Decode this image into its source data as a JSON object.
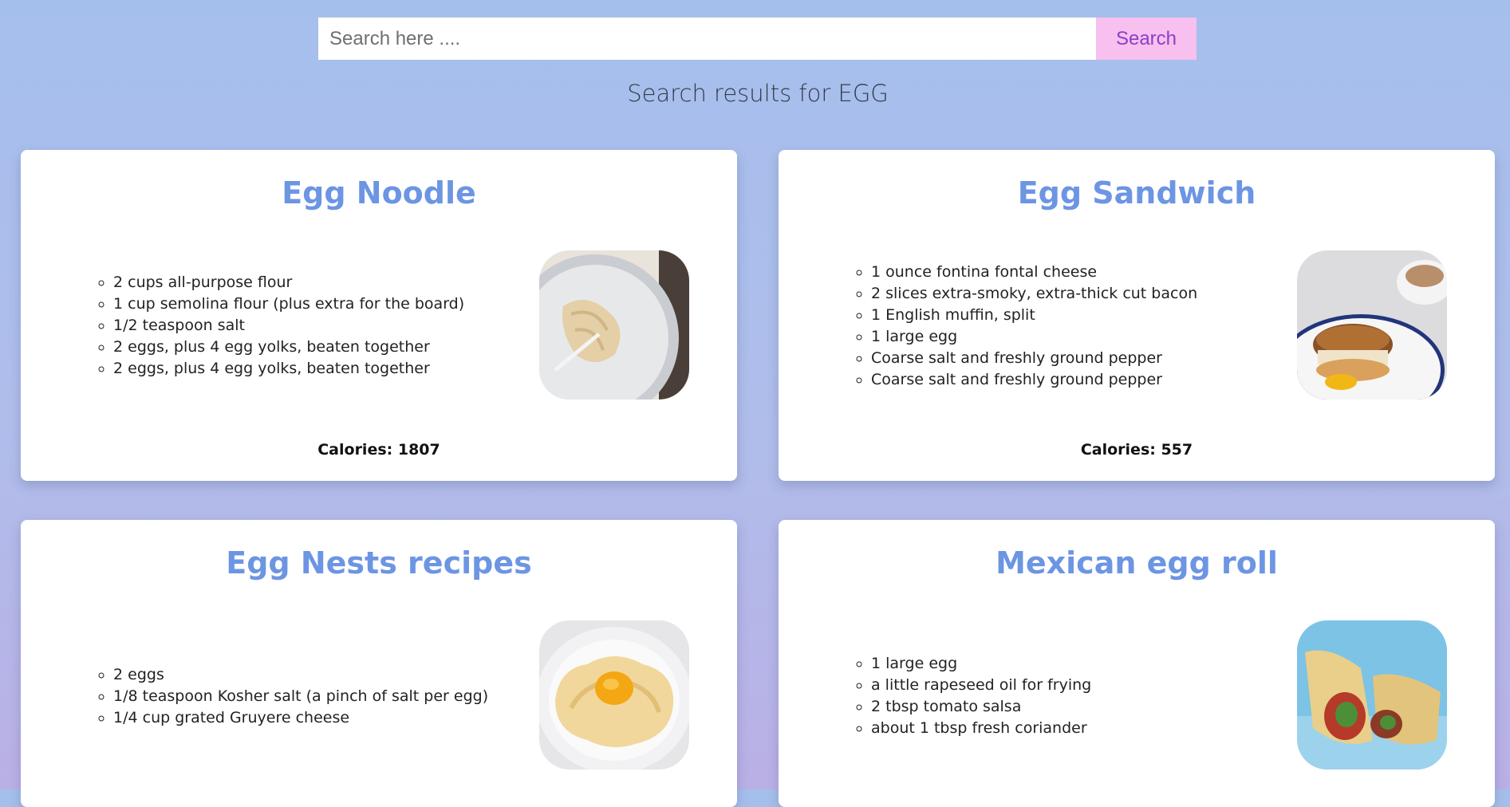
{
  "search": {
    "placeholder": "Search here ....",
    "button_label": "Search"
  },
  "results_heading": "Search results for EGG",
  "recipes": [
    {
      "title": "Egg Noodle",
      "ingredients": [
        "2 cups all-purpose flour",
        "1 cup semolina flour (plus extra for the board)",
        "1/2 teaspoon salt",
        "2 eggs, plus 4 egg yolks, beaten together",
        "2 eggs, plus 4 egg yolks, beaten together"
      ],
      "image_icon": "pasta-plate-image",
      "calories": "Calories: 1807"
    },
    {
      "title": "Egg Sandwich",
      "ingredients": [
        "1 ounce fontina fontal cheese",
        "2 slices extra-smoky, extra-thick cut bacon",
        "1 English muffin, split",
        "1 large egg",
        "Coarse salt and freshly ground pepper",
        "Coarse salt and freshly ground pepper"
      ],
      "image_icon": "egg-sandwich-image",
      "calories": "Calories: 557"
    },
    {
      "title": "Egg Nests recipes",
      "ingredients": [
        "2 eggs",
        "1/8 teaspoon Kosher salt (a pinch of salt per egg)",
        "1/4 cup grated Gruyere cheese"
      ],
      "image_icon": "egg-nest-image",
      "calories": ""
    },
    {
      "title": "Mexican egg roll",
      "ingredients": [
        "1 large egg",
        "a little rapeseed oil for frying",
        "2 tbsp tomato salsa",
        "about 1 tbsp fresh coriander"
      ],
      "image_icon": "egg-roll-image",
      "calories": ""
    }
  ],
  "colors": {
    "title": "#6c95e3",
    "search_button_bg": "#f7c0ee",
    "search_button_text": "#8a3fc9"
  }
}
